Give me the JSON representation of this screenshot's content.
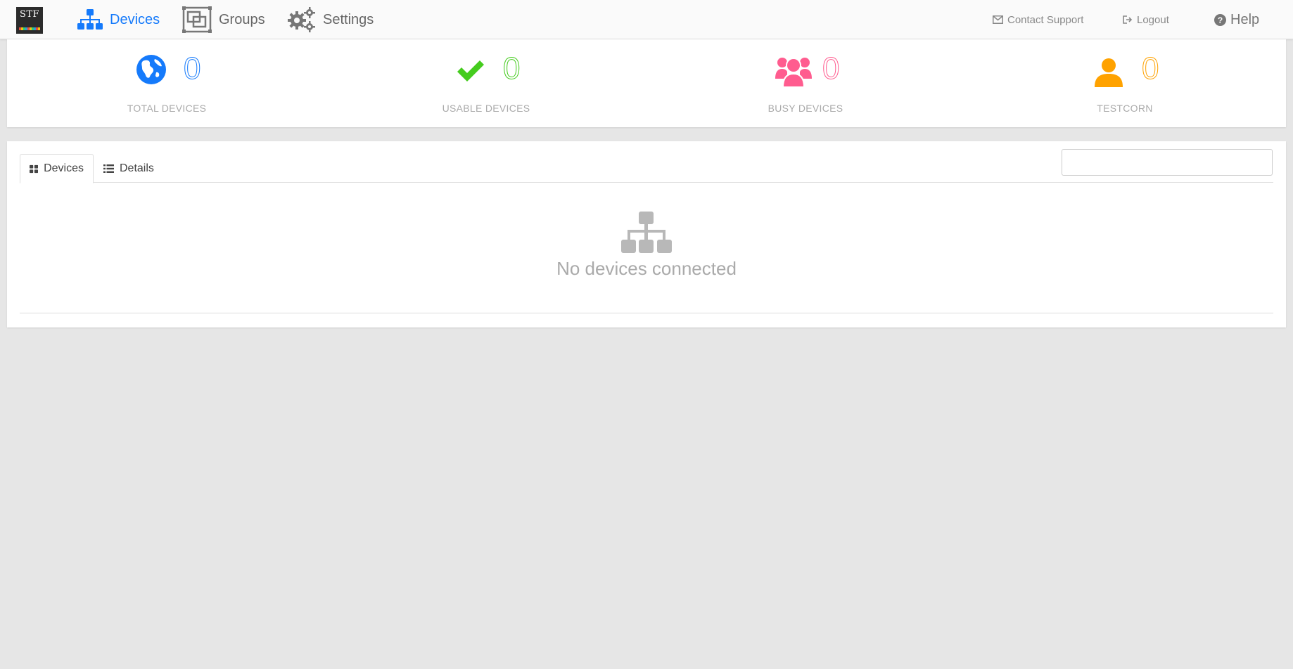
{
  "navbar": {
    "logo_text": "STF",
    "items": [
      {
        "label": "Devices",
        "icon": "sitemap-icon",
        "active": true
      },
      {
        "label": "Groups",
        "icon": "groups-icon",
        "active": false
      },
      {
        "label": "Settings",
        "icon": "gears-icon",
        "active": false
      }
    ],
    "right": {
      "contact_support": "Contact Support",
      "logout": "Logout",
      "help": "Help"
    }
  },
  "stats": [
    {
      "label": "TOTAL DEVICES",
      "count": "0",
      "color": "#157afb",
      "icon": "globe-icon"
    },
    {
      "label": "USABLE DEVICES",
      "count": "0",
      "color": "#45cc1e",
      "icon": "check-icon"
    },
    {
      "label": "BUSY DEVICES",
      "count": "0",
      "color": "#ff5c8f",
      "icon": "users-icon"
    },
    {
      "label": "TESTCORN",
      "count": "0",
      "color": "#ffa200",
      "icon": "user-icon"
    }
  ],
  "devices_panel": {
    "tabs": [
      {
        "label": "Devices",
        "icon": "th-large-icon",
        "active": true
      },
      {
        "label": "Details",
        "icon": "list-icon",
        "active": false
      }
    ],
    "search": {
      "value": "",
      "placeholder": ""
    },
    "empty_message": "No devices connected"
  }
}
